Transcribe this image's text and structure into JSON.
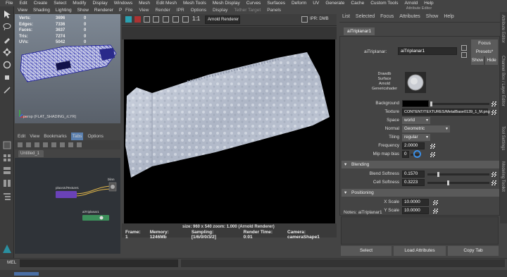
{
  "main_menu": [
    "File",
    "Edit",
    "Create",
    "Select",
    "Modify",
    "Display",
    "Windows",
    "Mesh",
    "Edit Mesh",
    "Mesh Tools",
    "Mesh Display",
    "Curves",
    "Surfaces",
    "Deform",
    "UV",
    "Generate",
    "Cache",
    "Custom Tools",
    "Arnold",
    "Help"
  ],
  "viewport": {
    "menu": [
      "View",
      "Shading",
      "Lighting",
      "Show",
      "Renderer",
      "Panels"
    ],
    "hud": [
      {
        "key": "Verts:",
        "value": "3696",
        "zero": "0"
      },
      {
        "key": "Edges:",
        "value": "7336",
        "zero": "0"
      },
      {
        "key": "Faces:",
        "value": "3637",
        "zero": "0"
      },
      {
        "key": "Tris:",
        "value": "7274",
        "zero": "0"
      },
      {
        "key": "UVs:",
        "value": "5042",
        "zero": "0"
      }
    ],
    "label": "persp (FLAT_SHADING_rLYR)"
  },
  "node_editor": {
    "menu": [
      "Edit",
      "View",
      "Bookmarks",
      "Tabs",
      "Options"
    ],
    "tab": "Untitled_1",
    "nodes": [
      "place2dTexture1",
      "aiTriplanar1",
      "blinn"
    ]
  },
  "render_view": {
    "menu": [
      "File",
      "View",
      "Render",
      "IPR",
      "Options",
      "Display",
      "Tether Target",
      "Panels"
    ],
    "ratio": "1:1",
    "renderer": "Arnold Renderer",
    "ipr": "IPR: DMB",
    "size_info": "size: 960 x 540  zoom: 1.000     (Arnold Renderer)",
    "status": [
      "Frame: 1",
      "Memory: 1246Mb",
      "Sampling: [1/6/0/0/3/2]",
      "Render Time: 0:01",
      "Camera: cameraShape1"
    ]
  },
  "attribute_editor": {
    "title": "Attribute Editor",
    "menu": [
      "List",
      "Selected",
      "Focus",
      "Attributes",
      "Show",
      "Help"
    ],
    "tab": "aiTriplanar1",
    "node_label": "aiTriplanar:",
    "node_name": "aiTriplanar1",
    "focus": "Focus",
    "presets": "Presets*",
    "show": "Show",
    "hide": "Hide",
    "swatch_caption": [
      "Drawdb",
      "Surface",
      "Arnold",
      "Genericshader"
    ],
    "fields": {
      "background_label": "Background",
      "texture_label": "Texture",
      "texture_value": "CONTENT/TEXTURES/MetalBase0139_1_M.png",
      "space_label": "Space",
      "space_value": "world",
      "normal_label": "Normal",
      "normal_value": "Geometric",
      "tiling_label": "Tiling",
      "tiling_value": "regular",
      "frequency_label": "Frequency",
      "frequency_value": "2.0000",
      "mip_label": "Mip map bias",
      "mip_value": "0",
      "blending_section": "Blending",
      "blend_softness_label": "Blend Softness",
      "blend_softness_value": "0.1570",
      "cell_softness_label": "Cell Softness",
      "cell_softness_value": "0.3223",
      "positioning_section": "Positioning",
      "xscale_label": "X Scale",
      "xscale_value": "10.0000",
      "yscale_label": "Y Scale",
      "yscale_value": "10.0000"
    },
    "notes_label": "Notes:  aiTriplanar1",
    "buttons": [
      "Select",
      "Load Attributes",
      "Copy Tab"
    ],
    "side_tabs": [
      "Attribute Editor",
      "Channel Box / Layer Editor",
      "Tool Settings",
      "Modeling Toolkit"
    ]
  },
  "command_line": {
    "label": "MEL"
  },
  "progress_fraction": 0.05
}
